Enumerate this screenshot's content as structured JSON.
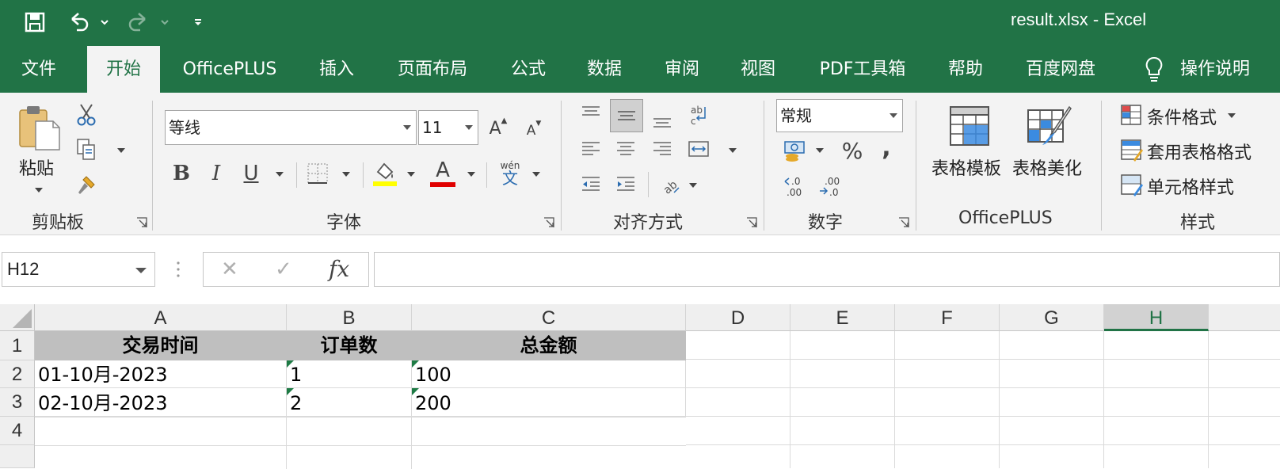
{
  "title": {
    "document": "result.xlsx  -  Excel"
  },
  "tabs": [
    {
      "label": "文件",
      "active": false
    },
    {
      "label": "开始",
      "active": true
    },
    {
      "label": "OfficePLUS",
      "active": false
    },
    {
      "label": "插入",
      "active": false
    },
    {
      "label": "页面布局",
      "active": false
    },
    {
      "label": "公式",
      "active": false
    },
    {
      "label": "数据",
      "active": false
    },
    {
      "label": "审阅",
      "active": false
    },
    {
      "label": "视图",
      "active": false
    },
    {
      "label": "PDF工具箱",
      "active": false
    },
    {
      "label": "帮助",
      "active": false
    },
    {
      "label": "百度网盘",
      "active": false
    },
    {
      "label": "操作说明",
      "active": false
    }
  ],
  "ribbon": {
    "clipboard": {
      "paste_label": "粘贴",
      "group_label": "剪贴板"
    },
    "font": {
      "font_name": "等线",
      "font_size": "11",
      "group_label": "字体",
      "bold": "B",
      "italic": "I",
      "underline": "U",
      "font_color_glyph": "A",
      "wen_top": "wén",
      "wen_bottom": "文"
    },
    "alignment": {
      "group_label": "对齐方式",
      "wrap_glyph": "ab\nc"
    },
    "number": {
      "format": "常规",
      "percent": "%",
      "comma": ",",
      "inc_decimal": ".0\n.00",
      "dec_decimal": ".00\n.0",
      "group_label": "数字"
    },
    "officeplus": {
      "table_template": "表格模板",
      "table_beautify": "表格美化",
      "group_label": "OfficePLUS"
    },
    "styles": {
      "conditional_format": "条件格式",
      "format_as_table": "套用表格格式",
      "cell_styles": "单元格样式",
      "group_label": "样式"
    }
  },
  "formula_bar": {
    "name_box": "H12",
    "cancel_glyph": "✕",
    "enter_glyph": "✓",
    "fx_glyph": "fx",
    "formula": ""
  },
  "sheet": {
    "columns": [
      "A",
      "B",
      "C",
      "D",
      "E",
      "F",
      "G",
      "H"
    ],
    "selected_column": "H",
    "rows": [
      "1",
      "2",
      "3",
      "4"
    ],
    "header_row": [
      "交易时间",
      "订单数",
      "总金额"
    ],
    "data_rows": [
      [
        "01-10月-2023",
        "1",
        "100"
      ],
      [
        "02-10月-2023",
        "2",
        "200"
      ]
    ]
  },
  "colors": {
    "brand": "#217346",
    "header_fill": "#bfbfbf",
    "error_indicator": "#1e7b45"
  }
}
